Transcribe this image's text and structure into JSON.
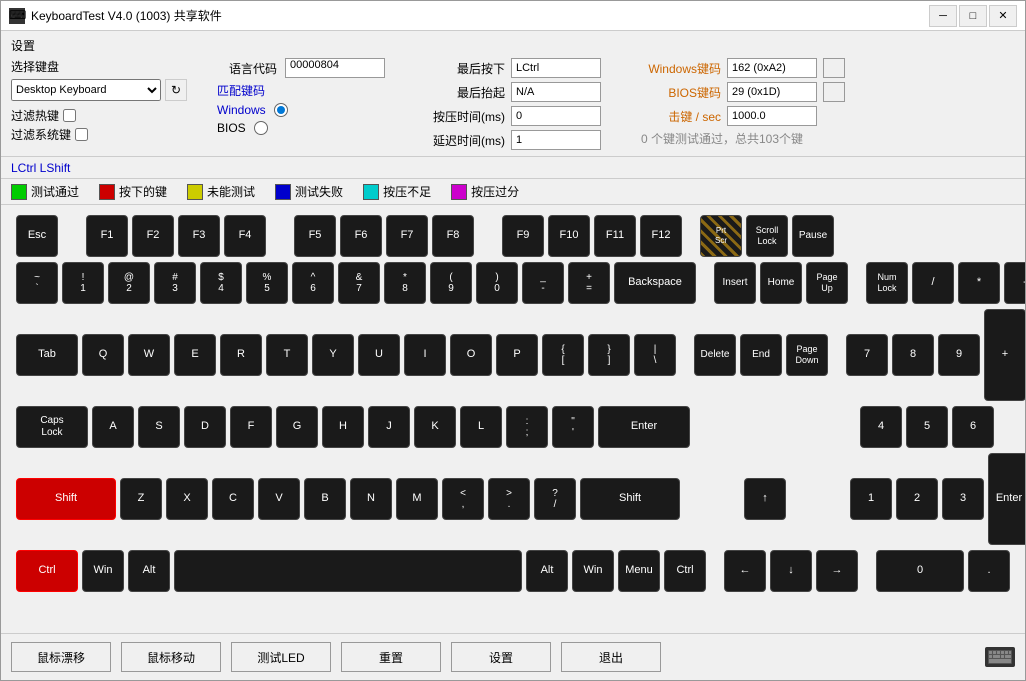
{
  "window": {
    "title": "KeyboardTest V4.0 (1003) 共享软件"
  },
  "titlebar": {
    "minimize": "─",
    "maximize": "□",
    "close": "✕"
  },
  "settings": {
    "title": "设置",
    "select_keyboard_label": "选择键盘",
    "keyboard_value": "Desktop Keyboard",
    "filter_hotkeys": "过滤热键",
    "filter_system": "过滤系统键",
    "lang_code_label": "语言代码",
    "lang_code_value": "00000804",
    "match_code_label": "匹配键码",
    "match_windows": "Windows",
    "match_bios": "BIOS",
    "last_press_label": "最后按下",
    "last_press_value": "LCtrl",
    "last_release_label": "最后抬起",
    "last_release_value": "N/A",
    "press_time_label": "按压时间(ms)",
    "press_time_value": "0",
    "delay_time_label": "延迟时间(ms)",
    "delay_time_value": "1",
    "windows_code_label": "Windows键码",
    "windows_code_value": "162 (0xA2)",
    "bios_code_label": "BIOS键码",
    "bios_code_value": "29 (0x1D)",
    "hits_label": "击键 / sec",
    "hits_value": "1000.0",
    "total_text": "0 个键测试通过，总共103个键"
  },
  "status_bar": {
    "text": "LCtrl LShift"
  },
  "legend": {
    "tested": "测试通过",
    "pressed": "按下的键",
    "untested": "未能测试",
    "failed": "测试失败",
    "insufficient": "按压不足",
    "excess": "按压过分",
    "colors": {
      "tested": "#00cc00",
      "pressed": "#cc0000",
      "untested": "#cccc00",
      "failed": "#0000cc",
      "insufficient": "#00cccc",
      "excess": "#cc00cc"
    }
  },
  "keys": {
    "esc": "Esc",
    "f1": "F1",
    "f2": "F2",
    "f3": "F3",
    "f4": "F4",
    "f5": "F5",
    "f6": "F6",
    "f7": "F7",
    "f8": "F8",
    "f9": "F9",
    "f10": "F10",
    "f11": "F11",
    "f12": "F12",
    "prtsc": "Prt\nScr",
    "scroll": "Scroll\nLock",
    "pause": "Pause",
    "tab": "Tab",
    "caps": "Caps\nLock",
    "shift_l": "Shift",
    "shift_r": "Shift",
    "ctrl_l": "Ctrl",
    "ctrl_r": "Ctrl",
    "win_l": "Win",
    "win_r": "Win",
    "alt_l": "Alt",
    "alt_r": "Alt",
    "menu": "Menu",
    "backspace": "Backspace",
    "enter": "Enter",
    "insert": "Insert",
    "home": "Home",
    "page_up": "Page\nUp",
    "delete": "Delete",
    "end": "End",
    "page_down": "Page\nDown",
    "num_lock": "Num\nLock",
    "num_slash": "/",
    "num_star": "*",
    "num_minus": "-",
    "num_7": "7",
    "num_8": "8",
    "num_9": "9",
    "num_plus": "+",
    "num_4": "4",
    "num_5": "5",
    "num_6": "6",
    "num_1": "1",
    "num_2": "2",
    "num_3": "3",
    "num_enter": "Enter",
    "num_0": "0",
    "num_dot": ".",
    "up": "↑",
    "down": "↓",
    "left": "←",
    "right": "→"
  },
  "bottom_buttons": {
    "mouse_hover": "鼠标漂移",
    "mouse_move": "鼠标移动",
    "test_led": "测试LED",
    "reset": "重置",
    "settings": "设置",
    "quit": "退出"
  }
}
